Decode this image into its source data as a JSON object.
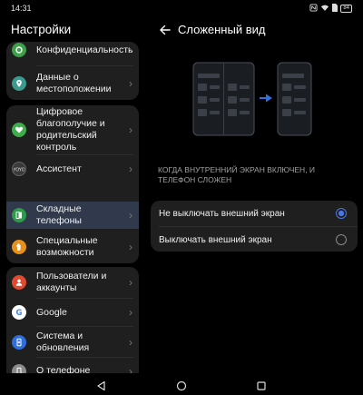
{
  "status_bar": {
    "time": "14:31",
    "battery": "84"
  },
  "settings_list": {
    "title": "Настройки",
    "items": [
      {
        "label": "Конфиденциальность",
        "icon": "privacy-icon",
        "color": "#3f9f4a"
      },
      {
        "label": "Данные о местоположении",
        "icon": "location-icon",
        "color": "#3b9a8e"
      },
      {
        "label": "Цифровое благополучие и родительский контроль",
        "icon": "heart-icon",
        "color": "#3eae4b"
      },
      {
        "label": "Ассистент",
        "icon": "assistant-icon",
        "color": "#3a3a3a"
      },
      {
        "label": "Складные телефоны",
        "icon": "foldable-phone-icon",
        "color": "#2e9a4a"
      },
      {
        "label": "Специальные возможности",
        "icon": "hand-icon",
        "color": "#e8901c"
      },
      {
        "label": "Пользователи и аккаунты",
        "icon": "user-icon",
        "color": "#e04a2e"
      },
      {
        "label": "Google",
        "icon": "google-icon",
        "color": "#ffffff"
      },
      {
        "label": "Система и обновления",
        "icon": "system-icon",
        "color": "#2f6fdd"
      },
      {
        "label": "О телефоне",
        "icon": "info-icon",
        "color": "#8a8a8a"
      }
    ],
    "selected": "Складные телефоны"
  },
  "detail": {
    "title": "Сложенный вид",
    "section_caption": "КОГДА ВНУТРЕННИЙ ЭКРАН ВКЛЮЧЕН, И ТЕЛЕФОН СЛОЖЕН",
    "options": [
      {
        "label": "Не выключать внешний экран",
        "selected": true
      },
      {
        "label": "Выключать внешний экран",
        "selected": false
      }
    ],
    "accent_color": "#4a76e8"
  }
}
